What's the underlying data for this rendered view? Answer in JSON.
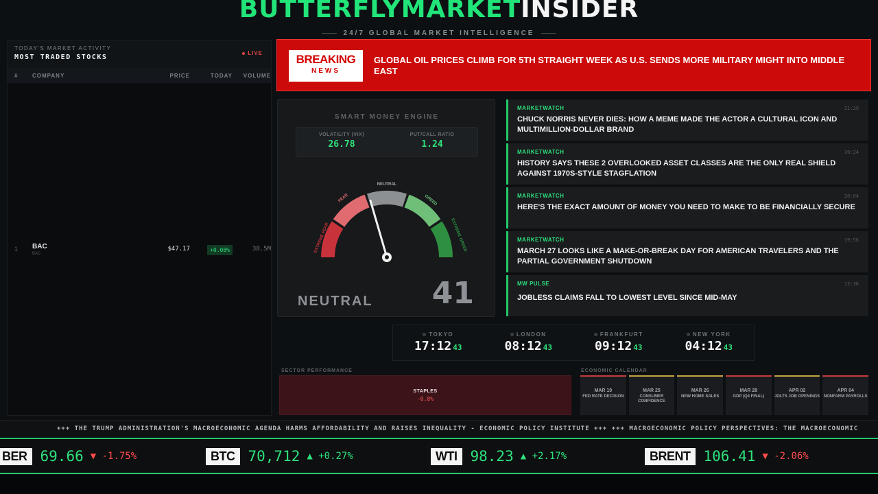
{
  "header": {
    "brand_part1": "BUTTERFLYMARKET",
    "brand_part2": "INSIDER",
    "tagline": "24/7 GLOBAL MARKET INTELLIGENCE"
  },
  "most_traded": {
    "subtitle": "TODAY'S MARKET ACTIVITY",
    "title": "MOST TRADED STOCKS",
    "live_label": "LIVE",
    "columns": [
      "#",
      "COMPANY",
      "PRICE",
      "TODAY",
      "VOLUME"
    ],
    "rows": [
      {
        "rank": "1",
        "name": "BAC",
        "sub": "BAC",
        "price": "$47.17",
        "today": "+0.08%",
        "volume": "38.5M"
      }
    ]
  },
  "breaking": {
    "badge_top": "BREAKING",
    "badge_bottom": "NEWS",
    "headline": "GLOBAL OIL PRICES CLIMB FOR 5TH STRAIGHT WEEK AS U.S. SENDS MORE MILITARY MIGHT INTO MIDDLE EAST"
  },
  "gauge": {
    "title": "SMART MONEY ENGINE",
    "vix_label": "VOLATILITY (VIX)",
    "vix_value": "26.78",
    "pc_label": "PUT/CALL RATIO",
    "pc_value": "1.24",
    "zones": [
      "EXTREME FEAR",
      "FEAR",
      "NEUTRAL",
      "GREED",
      "EXTREME GREED"
    ],
    "state": "NEUTRAL",
    "score": "41",
    "score_value": 41
  },
  "news": [
    {
      "source": "MARKETWATCH",
      "time": "21:29",
      "headline": "CHUCK NORRIS NEVER DIES: HOW A MEME MADE THE ACTOR A CULTURAL ICON AND MULTIMILLION-DOLLAR BRAND"
    },
    {
      "source": "MARKETWATCH",
      "time": "20:24",
      "headline": "HISTORY SAYS THESE 2 OVERLOOKED ASSET CLASSES ARE THE ONLY REAL SHIELD AGAINST 1970S-STYLE STAGFLATION"
    },
    {
      "source": "MARKETWATCH",
      "time": "20:04",
      "headline": "HERE'S THE EXACT AMOUNT OF MONEY YOU NEED TO MAKE TO BE FINANCIALLY SECURE"
    },
    {
      "source": "MARKETWATCH",
      "time": "19:56",
      "headline": "MARCH 27 LOOKS LIKE A MAKE-OR-BREAK DAY FOR AMERICAN TRAVELERS AND THE PARTIAL GOVERNMENT SHUTDOWN"
    },
    {
      "source": "MW PULSE",
      "time": "12:36",
      "headline": "JOBLESS CLAIMS FALL TO LOWEST LEVEL SINCE MID-MAY"
    }
  ],
  "clocks": [
    {
      "city": "TOKYO",
      "time": "17:12",
      "sec": "43"
    },
    {
      "city": "LONDON",
      "time": "08:12",
      "sec": "43"
    },
    {
      "city": "FRANKFURT",
      "time": "09:12",
      "sec": "43"
    },
    {
      "city": "NEW YORK",
      "time": "04:12",
      "sec": "43"
    }
  ],
  "sector": {
    "label": "SECTOR PERFORMANCE",
    "name": "STAPLES",
    "value": "-0.8%"
  },
  "calendar": {
    "label": "ECONOMIC CALENDAR",
    "events": [
      {
        "date": "MAR 19",
        "name": "FED RATE DECISION",
        "color": "red"
      },
      {
        "date": "MAR 25",
        "name": "CONSUMER CONFIDENCE",
        "color": "gold"
      },
      {
        "date": "MAR 26",
        "name": "NEW HOME SALES",
        "color": "gold"
      },
      {
        "date": "MAR 28",
        "name": "GDP (Q4 FINAL)",
        "color": "red"
      },
      {
        "date": "APR 02",
        "name": "JOLTS JOB OPENINGS",
        "color": "gold"
      },
      {
        "date": "APR 04",
        "name": "NONFARM PAYROLLS",
        "color": "red"
      }
    ]
  },
  "ticker_text": "+++ THE TRUMP ADMINISTRATION'S MACROECONOMIC AGENDA HARMS AFFORDABILITY AND RAISES INEQUALITY - ECONOMIC POLICY INSTITUTE +++ +++ MACROECONOMIC POLICY PERSPECTIVES: THE MACROECONOMIC",
  "prices": [
    {
      "sym": "BER",
      "price": "69.66",
      "change": "▼ -1.75%",
      "dir": "down"
    },
    {
      "sym": "BTC",
      "price": "70,712",
      "change": "▲ +0.27%",
      "dir": "up"
    },
    {
      "sym": "WTI",
      "price": "98.23",
      "change": "▲ +2.17%",
      "dir": "up"
    },
    {
      "sym": "BRENT",
      "price": "106.41",
      "change": "▼ -2.06%",
      "dir": "down"
    }
  ],
  "colors": {
    "accent": "#22e57a",
    "breaking": "#cc0a0a",
    "negative": "#ff4c4c"
  }
}
